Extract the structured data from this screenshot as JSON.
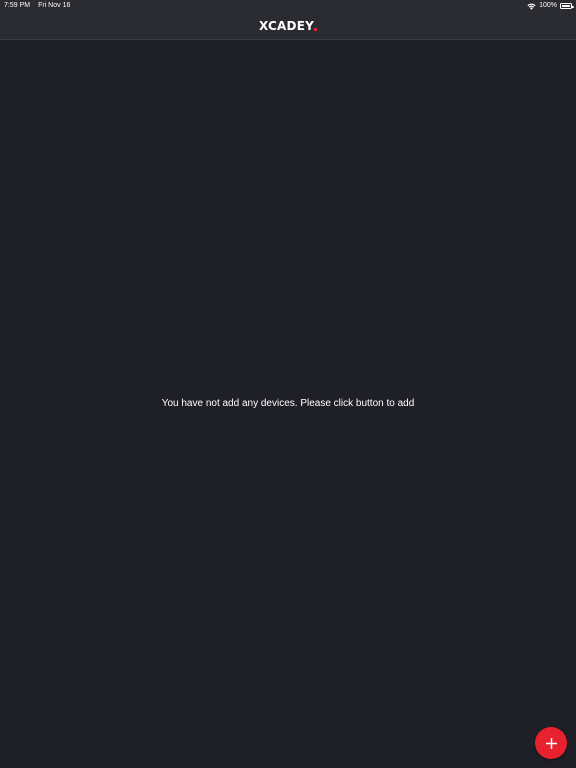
{
  "status_bar": {
    "time": "7:59 PM",
    "date": "Fri Nov 16",
    "battery_text": "100%",
    "battery_level": 1.0,
    "wifi_icon": "wifi-icon",
    "battery_icon": "battery-icon"
  },
  "header": {
    "logo_text": "XCADEY",
    "logo_accent_color": "#e8212e"
  },
  "main": {
    "empty_message": "You have not add any devices. Please click button to add"
  },
  "fab": {
    "icon": "plus-icon",
    "color": "#e8212e"
  },
  "colors": {
    "background": "#1f2027",
    "bar_background": "#2b2c31"
  }
}
